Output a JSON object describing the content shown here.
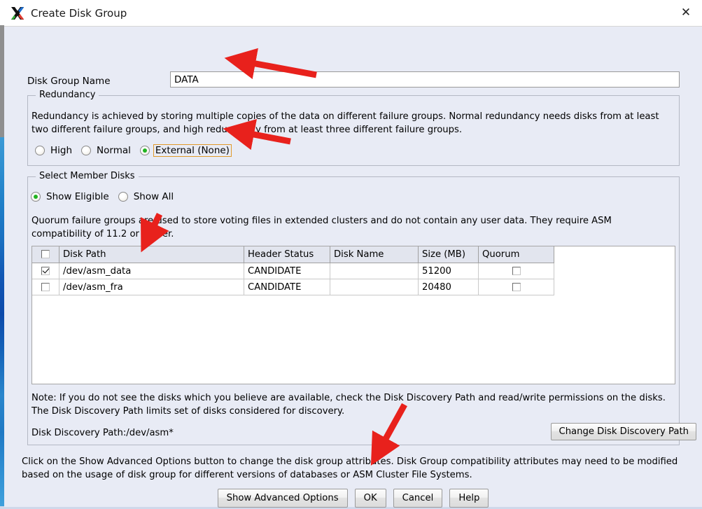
{
  "window": {
    "title": "Create Disk Group",
    "icon": "x-window-logo-icon",
    "close_label": "✕"
  },
  "form": {
    "disk_group_name_label": "Disk Group Name",
    "disk_group_name_value": "DATA",
    "disk_group_name_placeholder": ""
  },
  "redundancy": {
    "group_title": "Redundancy",
    "description": "Redundancy is achieved by storing multiple copies of the data on different failure groups. Normal redundancy needs disks from at least two different failure groups, and high redundancy from at least three different failure groups.",
    "options": [
      {
        "label": "High",
        "selected": false,
        "focused": false
      },
      {
        "label": "Normal",
        "selected": false,
        "focused": false
      },
      {
        "label": "External (None)",
        "selected": true,
        "focused": true
      }
    ]
  },
  "member_disks": {
    "group_title": "Select Member Disks",
    "filter_options": [
      {
        "label": "Show Eligible",
        "selected": true
      },
      {
        "label": "Show All",
        "selected": false
      }
    ],
    "quorum_note": "Quorum failure groups are used to store voting files in extended clusters and do not contain any user data. They require ASM compatibility of 11.2 or higher.",
    "columns": [
      "",
      "Disk Path",
      "Header Status",
      "Disk Name",
      "Size (MB)",
      "Quorum"
    ],
    "rows": [
      {
        "selected": true,
        "disk_path": "/dev/asm_data",
        "header_status": "CANDIDATE",
        "disk_name": "",
        "size_mb": "51200",
        "quorum": false
      },
      {
        "selected": false,
        "disk_path": "/dev/asm_fra",
        "header_status": "CANDIDATE",
        "disk_name": "",
        "size_mb": "20480",
        "quorum": false
      }
    ],
    "note": "Note: If you do not see the disks which you believe are available, check the Disk Discovery Path and read/write permissions on the disks. The Disk Discovery Path limits set of disks considered for discovery.",
    "discovery_path_label": "Disk Discovery Path:/dev/asm*",
    "change_discovery_path_button": "Change Disk Discovery Path"
  },
  "footer": {
    "description": "Click on the Show Advanced Options button to change the disk group attributes. Disk Group compatibility attributes may need to be modified based on the usage of disk group for different versions of databases or ASM Cluster File Systems.",
    "buttons": [
      {
        "label": "Show Advanced Options",
        "id": "show-advanced-options-button"
      },
      {
        "label": "OK",
        "id": "ok-button"
      },
      {
        "label": "Cancel",
        "id": "cancel-button"
      },
      {
        "label": "Help",
        "id": "help-button"
      }
    ]
  },
  "annotations": {
    "arrow_color": "#e8211c",
    "arrows": [
      {
        "name": "arrow-to-disk-group-name",
        "target": "Disk Group Name field"
      },
      {
        "name": "arrow-to-external-redundancy",
        "target": "External (None) radio"
      },
      {
        "name": "arrow-to-disk-row",
        "target": "/dev/asm_data row"
      },
      {
        "name": "arrow-to-ok-button",
        "target": "OK button"
      }
    ]
  },
  "colors": {
    "dialog_bg": "#e8ebf5",
    "titlebar_bg": "#ffffff",
    "field_bg": "#ffffff",
    "focus_outline": "#e09a2b",
    "radio_dot": "#21b321",
    "accent_strip": "#1257b4"
  }
}
